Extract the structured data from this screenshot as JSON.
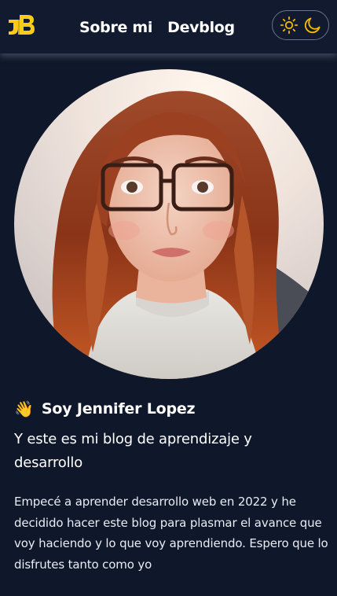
{
  "logo": {
    "text": "JB",
    "icon": "jb-monogram-logo",
    "color": "#facc15"
  },
  "nav": {
    "links": [
      {
        "label": "Sobre mi"
      },
      {
        "label": "Devblog"
      }
    ]
  },
  "theme_toggle": {
    "light_icon": "sun-icon",
    "dark_icon": "moon-icon",
    "icon_color": "#f5b800"
  },
  "profile": {
    "avatar": "profile-photo",
    "wave_emoji": "👋",
    "greeting": "Soy Jennifer Lopez",
    "subtitle": "Y este es mi blog de aprendizaje y desarrollo",
    "description": "Empecé a aprender desarrollo web en 2022 y he decidido hacer este blog para plasmar el avance que voy haciendo y lo que voy aprendiendo. Espero que lo disfrutes tanto como yo"
  },
  "colors": {
    "background": "#0f172a",
    "accent": "#facc15",
    "text": "#ffffff"
  }
}
